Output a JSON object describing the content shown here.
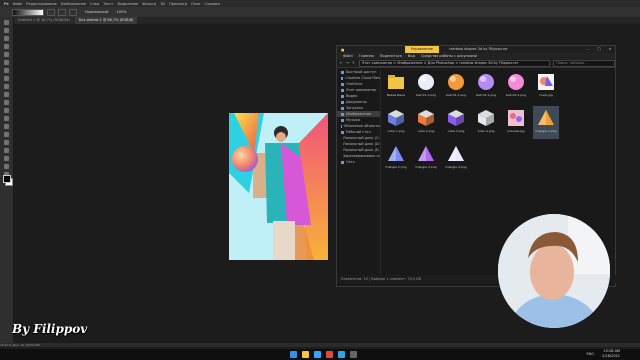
{
  "photoshop": {
    "logo": "Ps",
    "menu": [
      "Файл",
      "Редактирование",
      "Изображение",
      "Слои",
      "Текст",
      "Выделение",
      "Фильтр",
      "3D",
      "Просмотр",
      "Окно",
      "Справка"
    ],
    "doc_tabs": [
      {
        "label": "Untitled-1 @ 16,7% (RGB/8#)"
      },
      {
        "label": "Без-имени-1 @ 66,7% (RGB/8)"
      }
    ],
    "options": {
      "mode": "Нормальный",
      "opacity": "100%"
    },
    "status": "16,67%   Док: 10,1M/32,5M"
  },
  "explorer": {
    "manage_tab": "Управление",
    "title": "rainbow shapes 3d by Filippov.rar",
    "ribbon": [
      "Файл",
      "Главная",
      "Поделиться",
      "Вид",
      "Средства работы с рисунками"
    ],
    "address": "Этот компьютер  >  Изображения  >  Для Photoshop  >  rainbow shapes 3d by Filippov.rar",
    "search_placeholder": "Поиск: rainbow...",
    "nav": [
      {
        "label": "Быстрый доступ",
        "selected": false
      },
      {
        "label": "Creative Cloud Files",
        "selected": false
      },
      {
        "label": "OneDrive",
        "selected": false
      },
      {
        "label": "Этот компьютер",
        "selected": false
      },
      {
        "label": "Видео",
        "selected": false
      },
      {
        "label": "Документы",
        "selected": false
      },
      {
        "label": "Загрузки",
        "selected": false
      },
      {
        "label": "Изображения",
        "selected": true
      },
      {
        "label": "Музыка",
        "selected": false
      },
      {
        "label": "Объемные объекты",
        "selected": false
      },
      {
        "label": "Рабочий стол",
        "selected": false
      },
      {
        "label": "Локальный диск (C:)",
        "selected": false
      },
      {
        "label": "Локальный диск (D:)",
        "selected": false
      },
      {
        "label": "Локальный диск (E:)",
        "selected": false
      },
      {
        "label": "Зарезервировано сист",
        "selected": false
      },
      {
        "label": "Сеть",
        "selected": false
      }
    ],
    "files": [
      {
        "name": "Bebas Neue",
        "kind": "folder"
      },
      {
        "name": "ball 01-1.png",
        "kind": "ball",
        "color": "#e8eef7"
      },
      {
        "name": "ball 02-1.png",
        "kind": "ball",
        "color": "#f39a3c"
      },
      {
        "name": "ball 03-1.png",
        "kind": "ball",
        "color": "#b78cf0"
      },
      {
        "name": "ball 04-1.png",
        "kind": "ball",
        "color": "#f48bd8"
      },
      {
        "name": "cover.jpg",
        "kind": "cover"
      },
      {
        "name": "cube 1.png",
        "kind": "cube",
        "color": "#6a7fe0"
      },
      {
        "name": "cube 2.png",
        "kind": "cube",
        "color": "#f07a3a"
      },
      {
        "name": "cube 3.png",
        "kind": "cube",
        "color": "#8a5cf0"
      },
      {
        "name": "cube 4.png",
        "kind": "cube",
        "color": "#e6e6f0"
      },
      {
        "name": "preview.jpg",
        "kind": "preview"
      },
      {
        "name": "triangle 1.png",
        "kind": "triangle",
        "color": "#f0a030",
        "selected": true
      },
      {
        "name": "triangle 2.png",
        "kind": "triangle",
        "color": "#7a8cf0"
      },
      {
        "name": "triangle 3.png",
        "kind": "triangle",
        "color": "#b06af0"
      },
      {
        "name": "triangle 4.png",
        "kind": "triangle",
        "color": "#e8e8ff"
      }
    ],
    "status_bar": "Элементов: 15   |   Выбран 1 элемент: 75,0 КБ"
  },
  "watermark": "By Filippov",
  "taskbar": {
    "icons": [
      {
        "name": "windows-icon",
        "color": "#3a8ee6"
      },
      {
        "name": "explorer-icon",
        "color": "#f4c542"
      },
      {
        "name": "photoshop-icon",
        "color": "#31a8ff"
      },
      {
        "name": "chrome-icon",
        "color": "#e04a3a"
      },
      {
        "name": "telegram-icon",
        "color": "#2ea6e0"
      },
      {
        "name": "obs-icon",
        "color": "#666666"
      }
    ],
    "time": "10:28 AM",
    "date": "2/16/2021",
    "lang": "ENG"
  },
  "colors": {
    "accent": "#31a8ff",
    "manage_tab": "#f4c542"
  }
}
